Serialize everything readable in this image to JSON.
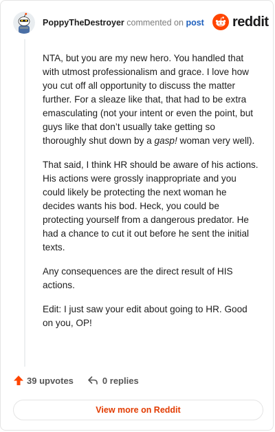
{
  "header": {
    "username": "PoppyTheDestroyer",
    "commented_text": "commented on",
    "post_link": "post",
    "logo_text": "reddit"
  },
  "colors": {
    "brand": "#ff4500",
    "link": "#1d5fbd",
    "upvote": "#ff4500"
  },
  "comment": {
    "p1_a": "NTA, but you are my new hero. You handled that with utmost professionalism and grace. I love how you cut off all opportunity to discuss the matter further. For a sleaze like that, that had to be extra emasculating (not your intent or even the point, but guys like that don’t usually take getting so thoroughly shut down by a ",
    "p1_em": "gasp!",
    "p1_b": " woman very well).",
    "p2": "That said, I think HR should be aware of his actions. His actions were grossly inappropriate and you could likely be protecting the next woman he decides wants his bod. Heck, you could be protecting yourself from a dangerous predator. He had a chance to cut it out before he sent the initial texts.",
    "p3": "Any consequences are the direct result of HIS actions.",
    "p4": "Edit: I just saw your edit about going to HR. Good on you, OP!"
  },
  "footer": {
    "upvotes": "39 upvotes",
    "replies": "0 replies",
    "view_more": "View more on Reddit"
  },
  "icons": {
    "avatar": "snoo-avatar",
    "logo": "reddit-snoo-logo",
    "upvote": "upvote-arrow-icon",
    "reply": "reply-arrow-icon"
  }
}
